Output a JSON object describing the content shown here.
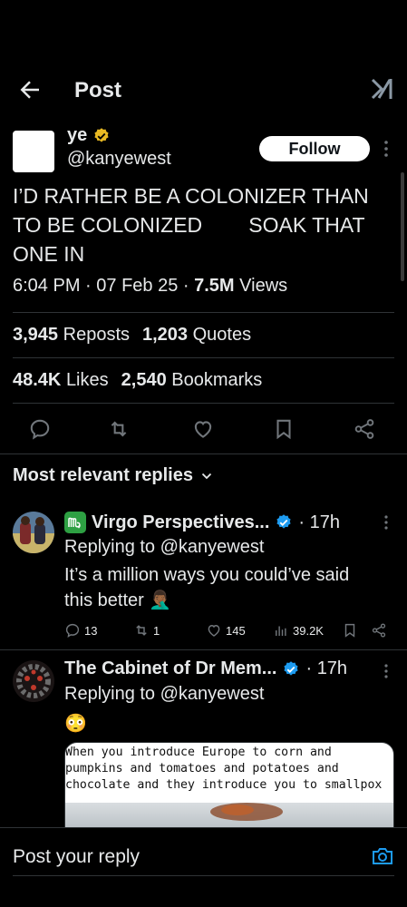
{
  "header": {
    "title": "Post"
  },
  "post": {
    "author_name": "ye",
    "author_handle": "@kanyewest",
    "follow_label": "Follow",
    "text_lines": [
      "I’D RATHER BE A COLONIZER THAN",
      "TO BE COLONIZED        SOAK THAT",
      "ONE IN"
    ],
    "time": "6:04 PM",
    "date": "07 Feb 25",
    "views_count": "7.5M",
    "views_label": "Views",
    "reposts_count": "3,945",
    "reposts_label": "Reposts",
    "quotes_count": "1,203",
    "quotes_label": "Quotes",
    "likes_count": "48.4K",
    "likes_label": "Likes",
    "bookmarks_count": "2,540",
    "bookmarks_label": "Bookmarks"
  },
  "replies_section": {
    "label": "Most relevant replies"
  },
  "replies": [
    {
      "name": "Virgo Perspectives...",
      "time": "17h",
      "replying_to": "Replying to @kanyewest",
      "text_line1": "It’s a million ways you could’ve said",
      "text_line2": "this better",
      "emoji": "🤦🏾‍♂️",
      "replies_count": "13",
      "reposts_count": "1",
      "likes_count": "145",
      "views_count": "39.2K"
    },
    {
      "name": "The Cabinet of Dr Mem...",
      "time": "17h",
      "replying_to": "Replying to @kanyewest",
      "emoji": "😳",
      "card_lines": [
        "When you introduce Europe to corn and",
        "pumpkins and tomatoes and potatoes and",
        "chocolate and they introduce you to smallpox"
      ]
    }
  ],
  "composer": {
    "placeholder": "Post your reply"
  },
  "colors": {
    "background": "#000000",
    "text": "#e7e9ea",
    "divider": "#2f3336",
    "verified_blue": "#1d9bf0",
    "verified_gold": "#e8b923"
  },
  "icons": [
    "back-arrow-icon",
    "grok-icon",
    "gold-verified-icon",
    "more-icon",
    "reply-icon",
    "repost-icon",
    "like-icon",
    "bookmark-icon",
    "share-icon",
    "chevron-down-icon",
    "virgo-icon",
    "blue-verified-icon",
    "views-icon",
    "camera-icon"
  ]
}
